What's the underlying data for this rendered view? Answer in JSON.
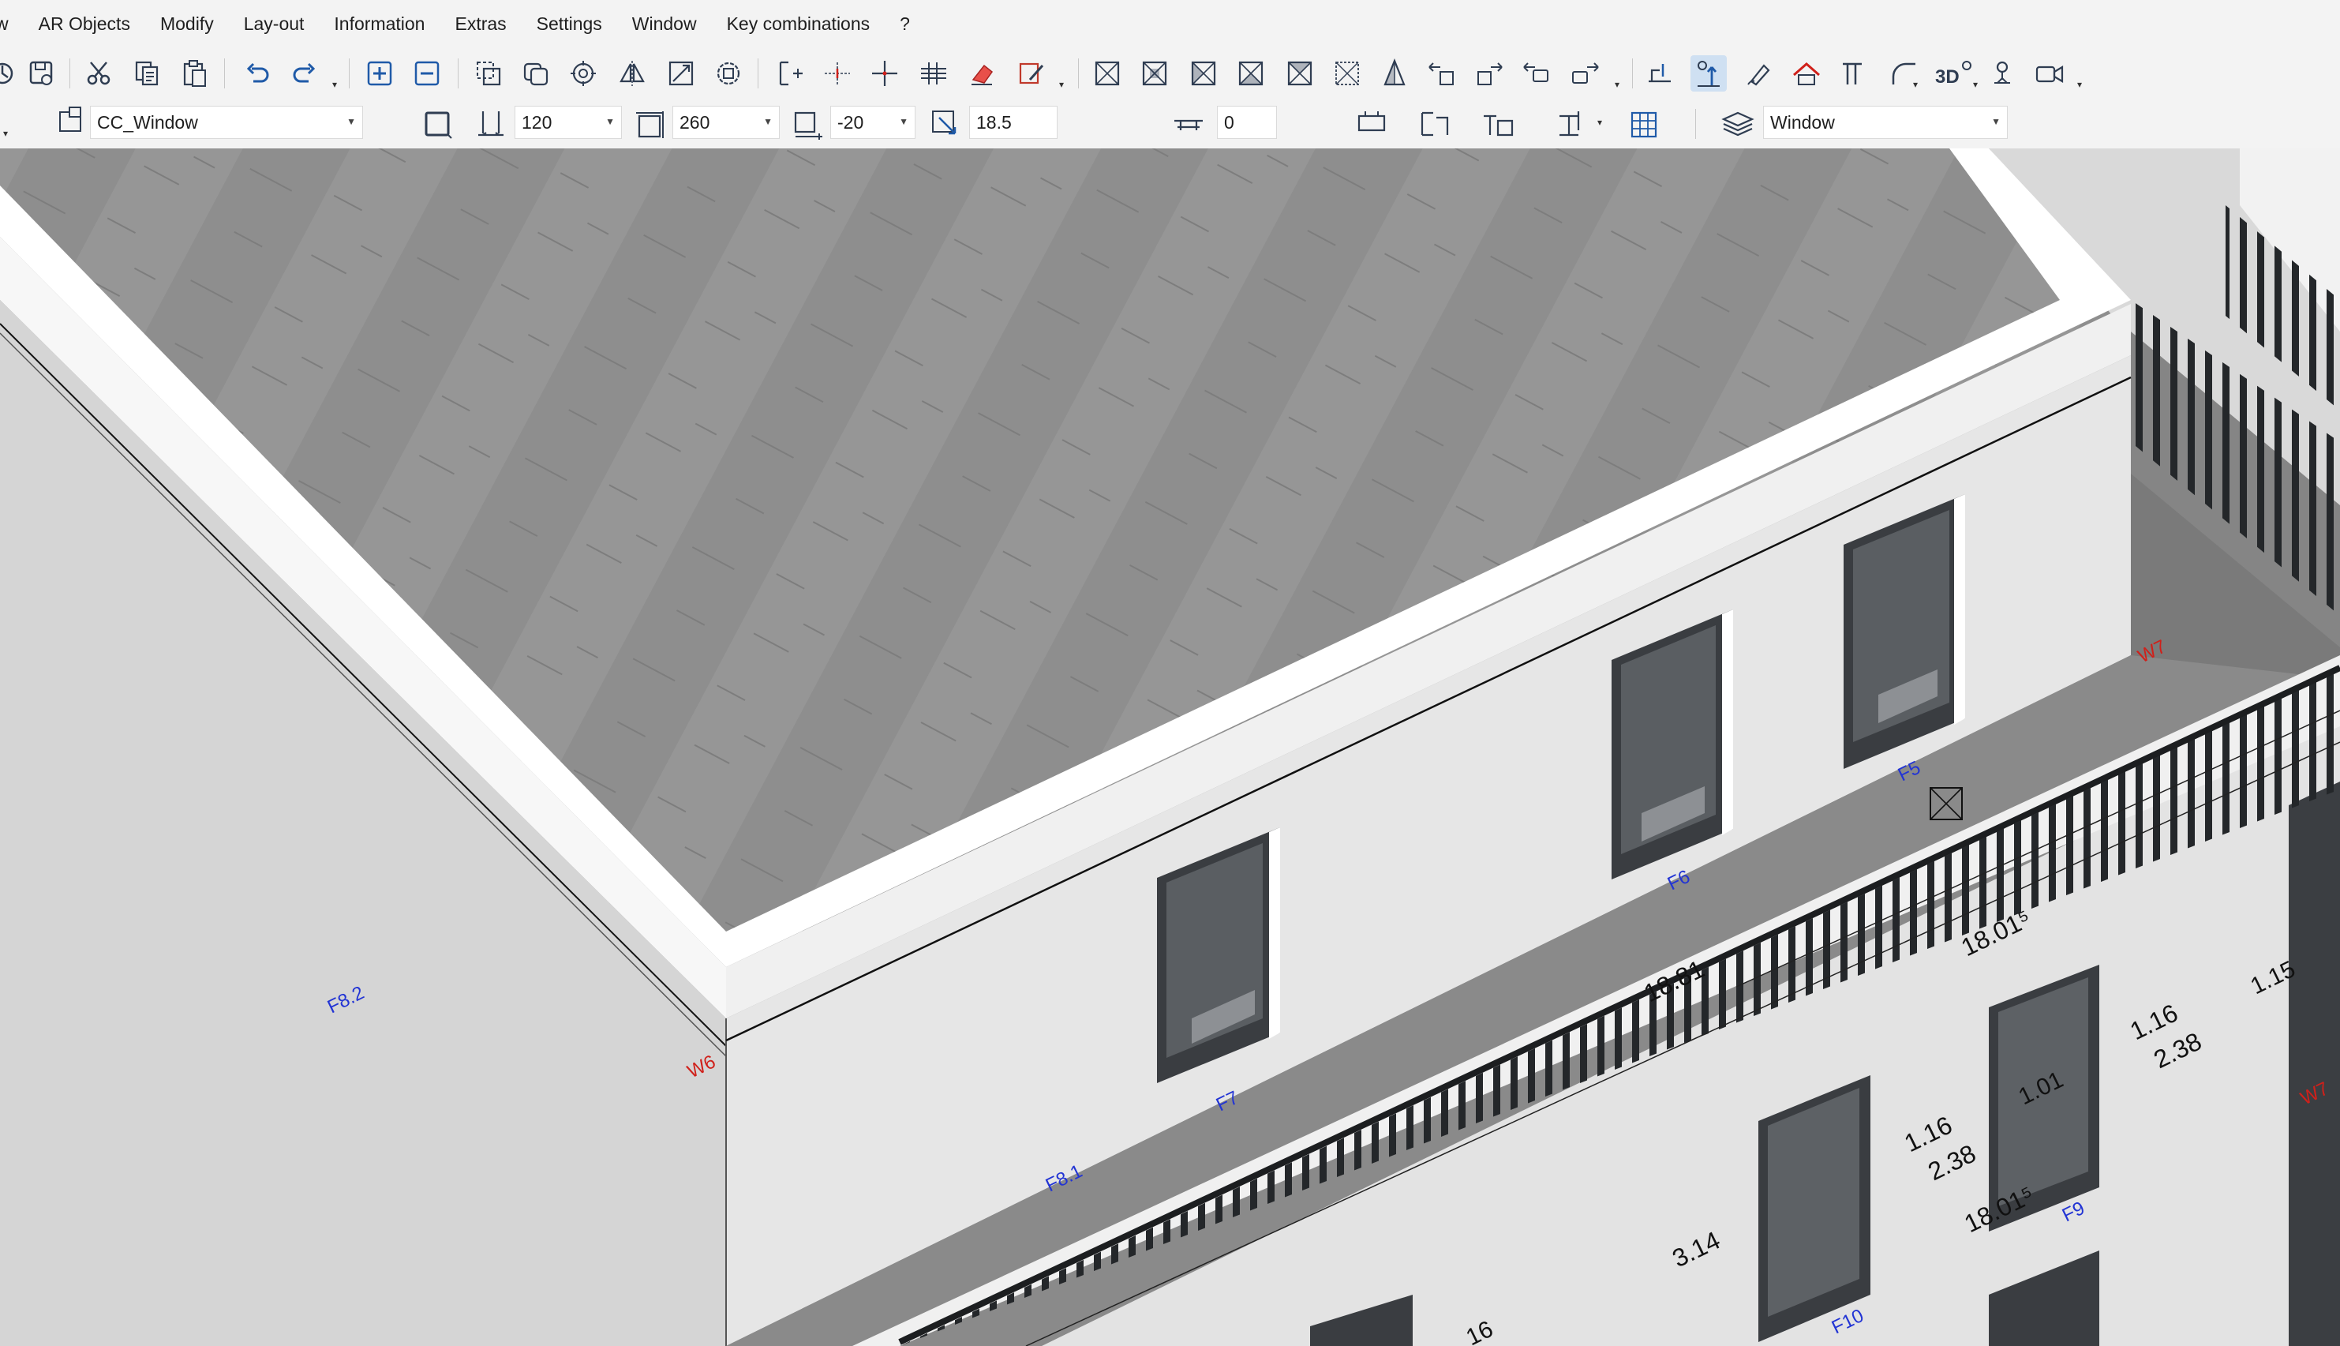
{
  "menu": [
    "w",
    "AR Objects",
    "Modify",
    "Lay-out",
    "Information",
    "Extras",
    "Settings",
    "Window",
    "Key combinations",
    "?"
  ],
  "toolbar": {
    "icons": [
      "open-icon",
      "save-icon",
      "cut-icon",
      "copy-icon",
      "paste-icon",
      "undo-icon",
      "redo-icon",
      "zoom-in-icon",
      "zoom-out-icon",
      "transform-icon",
      "view-3d-icon",
      "camera-icon"
    ],
    "active_tool": "pick-point-icon"
  },
  "properties": {
    "style": "CC_Window",
    "width": "120",
    "height": "260",
    "offset": "-20",
    "depth": "18.5",
    "sill": "0",
    "layer": "Window"
  },
  "view": {
    "axis_labels": {
      "w6": "W6",
      "w7": "W7",
      "w7b": "W7",
      "f5": "F5",
      "f6": "F6",
      "f7": "F7",
      "f81": "F8.1",
      "f82": "F8.2",
      "f9": "F9",
      "f10": "F10"
    },
    "dimensions": {
      "d1801a": "18.01⁵",
      "d1801b": "18.01⁵",
      "d1881": "18.81",
      "d116a": "1.16",
      "d238a": "2.38",
      "d116b": "1.16",
      "d238b": "2.38",
      "d101": "1.01",
      "d115": "1.15",
      "d314": "3.14",
      "d16": "16"
    },
    "colors": {
      "roof": "#8f8f8f",
      "wall": "#e7e7e7",
      "parapet": "#ffffff",
      "railing": "#26292c",
      "axis_red": "#d0201a",
      "axis_blue": "#2234d4"
    }
  }
}
